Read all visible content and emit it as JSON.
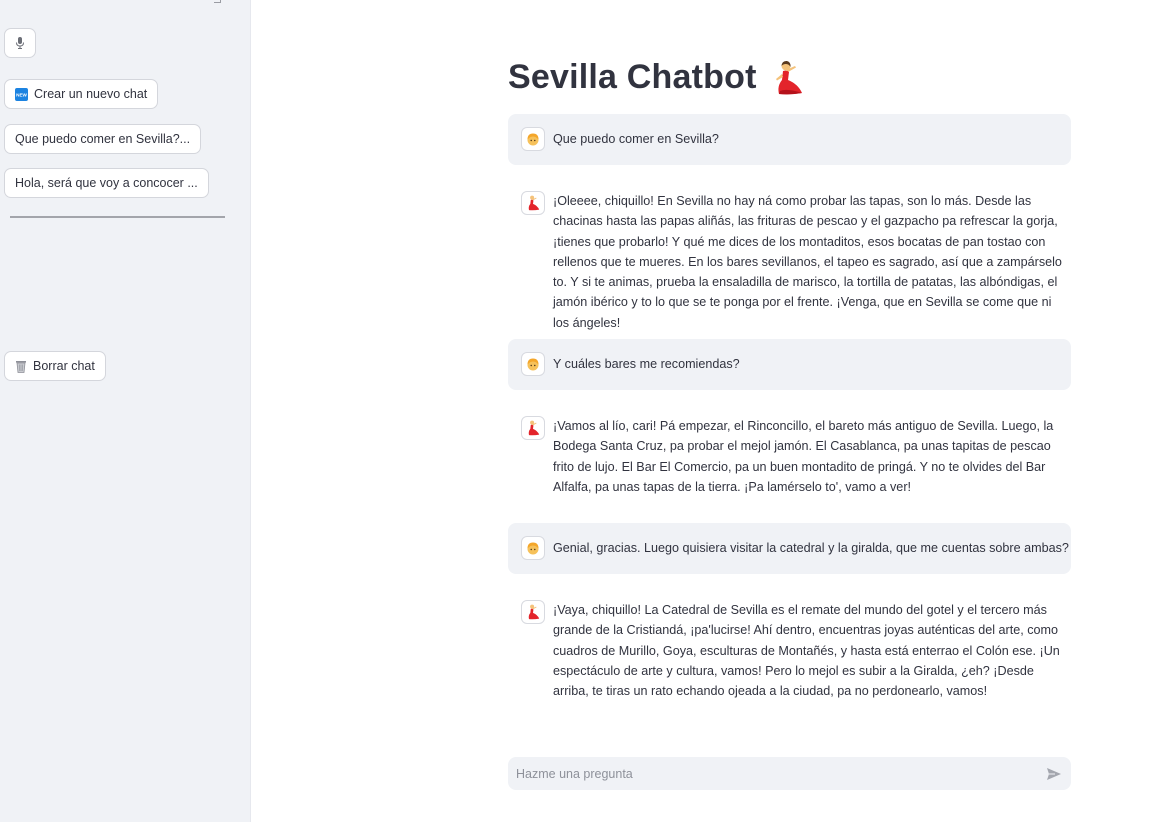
{
  "sidebar": {
    "mic_icon": "microphone-icon",
    "new_chat": {
      "icon": "new-badge-icon",
      "label": "Crear un nuevo chat"
    },
    "history": [
      {
        "label": "Que puedo comer en Sevilla?..."
      },
      {
        "label": "Hola, será que voy a concocer ..."
      }
    ],
    "clear_chat": {
      "icon": "wastebasket-icon",
      "label": "Borrar chat"
    }
  },
  "main": {
    "title": "Sevilla Chatbot",
    "title_icon": "flamenco-dancer-icon",
    "messages": [
      {
        "role": "user",
        "avatar": "person-blond-hair-icon",
        "text": "Que puedo comer en Sevilla?"
      },
      {
        "role": "assistant",
        "avatar": "flamenco-dancer-icon",
        "text": "¡Oleeee, chiquillo! En Sevilla no hay ná como probar las tapas, son lo más. Desde las chacinas hasta las papas aliñás, las frituras de pescao y el gazpacho pa refrescar la gorja, ¡tienes que probarlo! Y qué me dices de los montaditos, esos bocatas de pan tostao con rellenos que te mueres. En los bares sevillanos, el tapeo es sagrado, así que a zampárselo to. Y si te animas, prueba la ensaladilla de marisco, la tortilla de patatas, las albóndigas, el jamón ibérico y to lo que se te ponga por el frente. ¡Venga, que en Sevilla se come que ni los ángeles!"
      },
      {
        "role": "user",
        "avatar": "person-blond-hair-icon",
        "text": "Y cuáles bares me recomiendas?"
      },
      {
        "role": "assistant",
        "avatar": "flamenco-dancer-icon",
        "text": "¡Vamos al lío, cari! Pá empezar, el Rinconcillo, el bareto más antiguo de Sevilla. Luego, la Bodega Santa Cruz, pa probar el mejol jamón. El Casablanca, pa unas tapitas de pescao frito de lujo. El Bar El Comercio, pa un buen montadito de pringá. Y no te olvides del Bar Alfalfa, pa unas tapas de la tierra. ¡Pa lamérselo to', vamo a ver!"
      },
      {
        "role": "user",
        "avatar": "person-blond-hair-icon",
        "text": "Genial, gracias. Luego quisiera visitar la catedral y la giralda, que me cuentas sobre ambas?"
      },
      {
        "role": "assistant",
        "avatar": "flamenco-dancer-icon",
        "text": "¡Vaya, chiquillo! La Catedral de Sevilla es el remate del mundo del gotel y el tercero más grande de la Cristiandá, ¡pa'lucirse! Ahí dentro, encuentras joyas auténticas del arte, como cuadros de Murillo, Goya, esculturas de Montañés, y hasta está enterrao el Colón ese. ¡Un espectáculo de arte y cultura, vamos! Pero lo mejol es subir a la Giralda, ¿eh? ¡Desde arriba, te tiras un rato echando ojeada a la ciudad, pa no perdonearlo, vamos!"
      }
    ]
  },
  "chat_input": {
    "placeholder": "Hazme una pregunta",
    "send_icon": "send-icon"
  },
  "colors": {
    "sidebar_bg": "#f0f2f6",
    "user_bubble_bg": "#f0f2f6",
    "text": "#31333f",
    "new_badge": "#1c83e1",
    "dancer_dress": "#e3242b"
  }
}
